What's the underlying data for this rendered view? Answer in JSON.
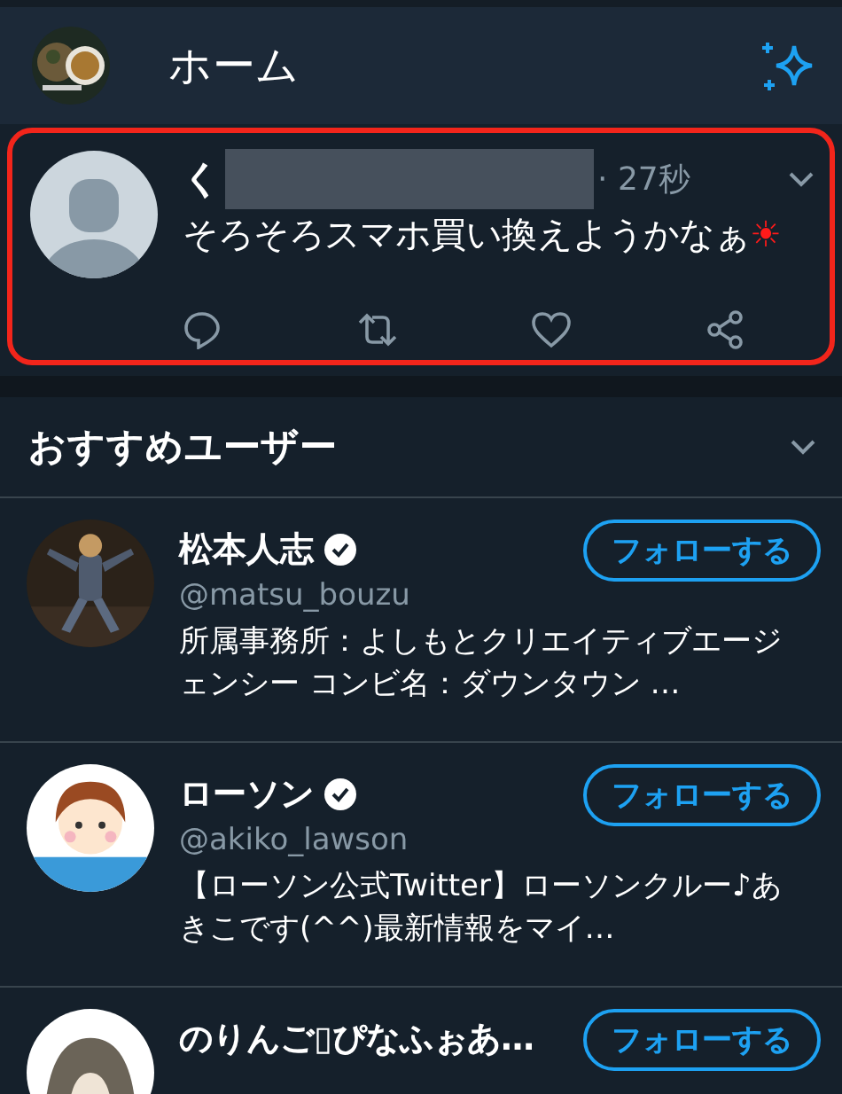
{
  "header": {
    "title": "ホーム"
  },
  "tweet": {
    "highlighted": true,
    "name_start": "く",
    "name_redacted": true,
    "time": "· 27秒",
    "text": "そろそろスマホ買い換えようかなぁ",
    "emoji": "☀"
  },
  "recommended": {
    "title": "おすすめユーザー",
    "users": [
      {
        "name": "松本人志",
        "verified": true,
        "handle": "@matsu_bouzu",
        "bio": "所属事務所：よしもとクリエイティブエージェンシー コンビ名：ダウンタウン …",
        "follow_label": "フォローする"
      },
      {
        "name": "ローソン",
        "verified": true,
        "handle": "@akiko_lawson",
        "bio": "【ローソン公式Twitter】ローソンクルー♪あきこです(^^)最新情報をマイ…",
        "follow_label": "フォローする"
      },
      {
        "name": "のりんご▯ぴなふぉあ…",
        "follow_label": "フォローする"
      }
    ]
  }
}
